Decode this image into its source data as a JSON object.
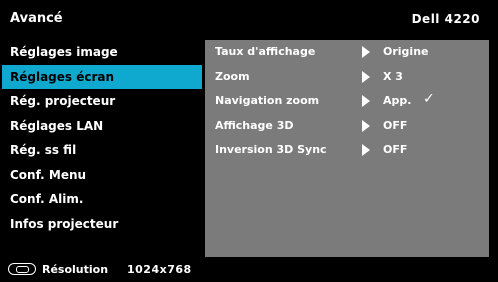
{
  "header": {
    "menu_title": "Avancé",
    "model": "Dell 4220"
  },
  "sidebar": {
    "items": [
      {
        "label": "Réglages image",
        "selected": false
      },
      {
        "label": "Réglages écran",
        "selected": true
      },
      {
        "label": "Rég. projecteur",
        "selected": false
      },
      {
        "label": "Réglages LAN",
        "selected": false
      },
      {
        "label": "Rég. ss fil",
        "selected": false
      },
      {
        "label": "Conf. Menu",
        "selected": false
      },
      {
        "label": "Conf. Alim.",
        "selected": false
      },
      {
        "label": "Infos projecteur",
        "selected": false
      }
    ]
  },
  "panel": {
    "rows": [
      {
        "label": "Taux d'affichage",
        "value": "Origine"
      },
      {
        "label": "Zoom",
        "value": "X 3"
      },
      {
        "label": "Navigation zoom",
        "value": "App.",
        "check": "✓"
      },
      {
        "label": "Affichage 3D",
        "value": "OFF"
      },
      {
        "label": "Inversion 3D Sync",
        "value": "OFF"
      }
    ]
  },
  "footer": {
    "resolution_label": "Résolution",
    "resolution_value": "1024x768"
  },
  "colors": {
    "background": "#000000",
    "selected": "#0fa8cf",
    "panel": "#7b7b7b",
    "text": "#ffffff"
  }
}
